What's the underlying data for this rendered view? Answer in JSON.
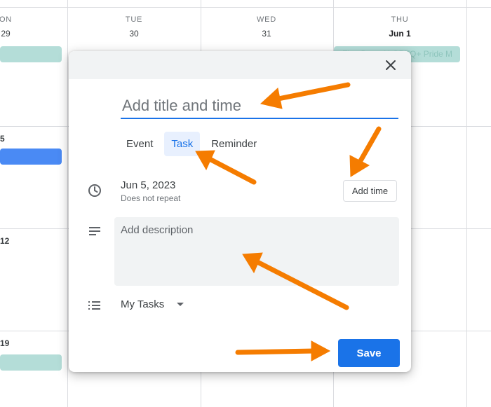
{
  "calendar": {
    "days": [
      {
        "name": "ON",
        "number": "29"
      },
      {
        "name": "TUE",
        "number": "30"
      },
      {
        "name": "WED",
        "number": "31"
      },
      {
        "name": "THU",
        "number": "Jun 1"
      }
    ],
    "week_numbers": [
      "5",
      "12",
      "19"
    ],
    "event_thursday": "First Day of LGBTQ+ Pride M"
  },
  "dialog": {
    "title_placeholder": "Add title and time",
    "tabs": [
      {
        "label": "Event",
        "active": false
      },
      {
        "label": "Task",
        "active": true
      },
      {
        "label": "Reminder",
        "active": false
      }
    ],
    "date": "Jun 5, 2023",
    "repeat": "Does not repeat",
    "add_time_label": "Add time",
    "description_placeholder": "Add description",
    "task_list": "My Tasks",
    "save_label": "Save"
  },
  "icons": {
    "close": "close-icon",
    "clock": "clock-icon",
    "notes": "notes-icon",
    "list": "list-icon",
    "caret": "caret-down-icon"
  },
  "colors": {
    "accent": "#1a73e8",
    "arrow": "#f57c00",
    "event_teal": "#b4ddd8",
    "event_blue": "#4a8af4"
  }
}
